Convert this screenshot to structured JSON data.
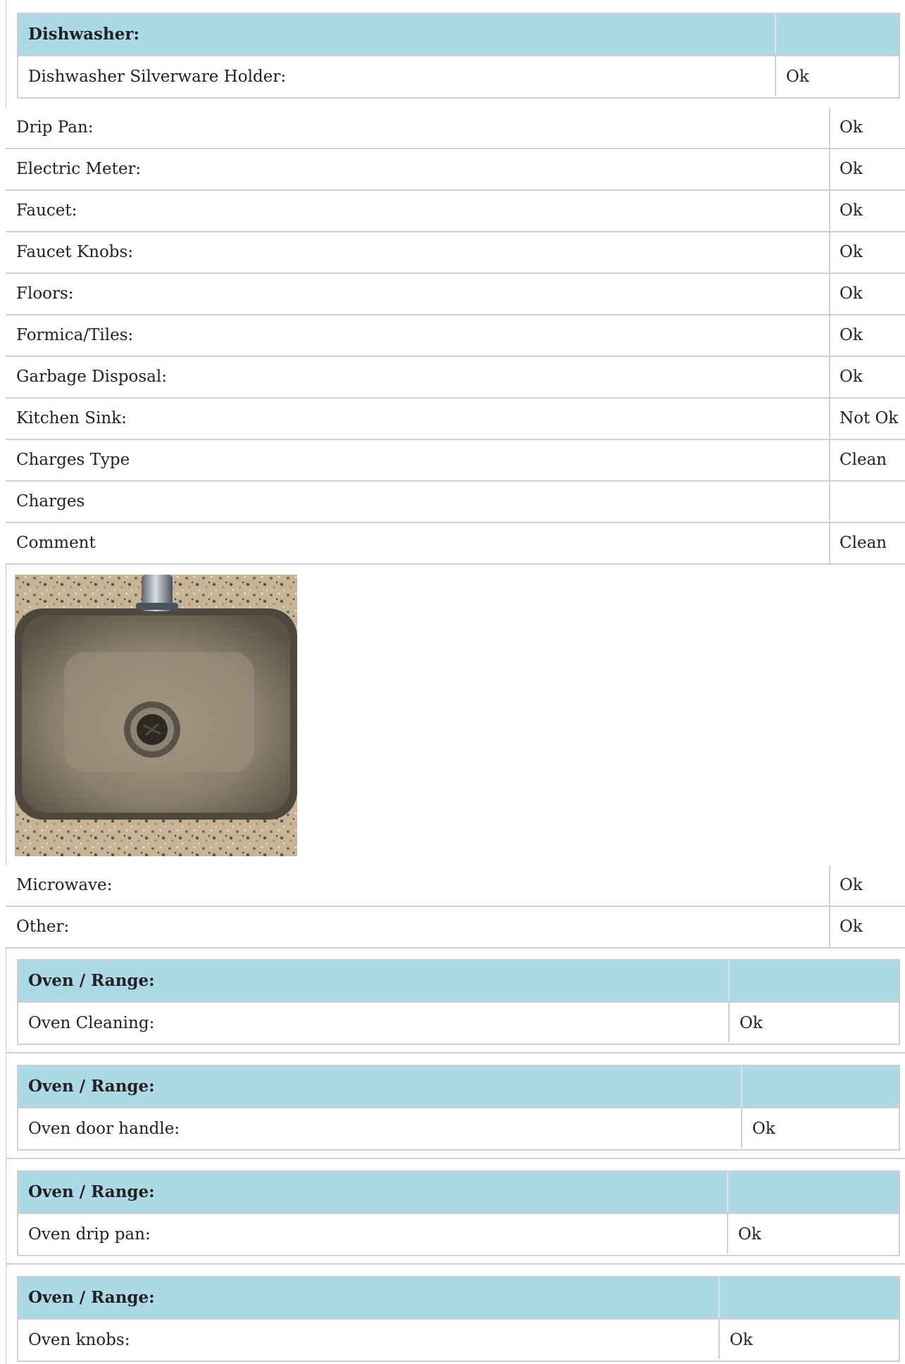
{
  "dishwasher": {
    "header": "Dishwasher:",
    "item_label": "Dishwasher Silverware Holder:",
    "item_value": "Ok"
  },
  "rows_a": [
    {
      "label": "Drip Pan:",
      "value": "Ok"
    },
    {
      "label": "Electric Meter:",
      "value": "Ok"
    },
    {
      "label": "Faucet:",
      "value": "Ok"
    },
    {
      "label": "Faucet Knobs:",
      "value": "Ok"
    },
    {
      "label": "Floors:",
      "value": "Ok"
    },
    {
      "label": "Formica/Tiles:",
      "value": "Ok"
    },
    {
      "label": "Garbage Disposal:",
      "value": "Ok"
    },
    {
      "label": "Kitchen Sink:",
      "value": "Not Ok"
    },
    {
      "label": "Charges Type",
      "value": "Clean"
    },
    {
      "label": "Charges",
      "value": ""
    },
    {
      "label": "Comment",
      "value": "Clean"
    }
  ],
  "rows_b": [
    {
      "label": "Microwave:",
      "value": "Ok"
    },
    {
      "label": "Other:",
      "value": "Ok"
    }
  ],
  "oven_sections": [
    {
      "header": "Oven / Range:",
      "item_label": "Oven Cleaning:",
      "item_value": "Ok"
    },
    {
      "header": "Oven / Range:",
      "item_label": "Oven door handle:",
      "item_value": "Ok"
    },
    {
      "header": "Oven / Range:",
      "item_label": "Oven drip pan:",
      "item_value": "Ok"
    },
    {
      "header": "Oven / Range:",
      "item_label": "Oven knobs:",
      "item_value": "Ok"
    }
  ],
  "colors": {
    "header_bg": "#add8e6",
    "border": "#cfcfcf"
  }
}
